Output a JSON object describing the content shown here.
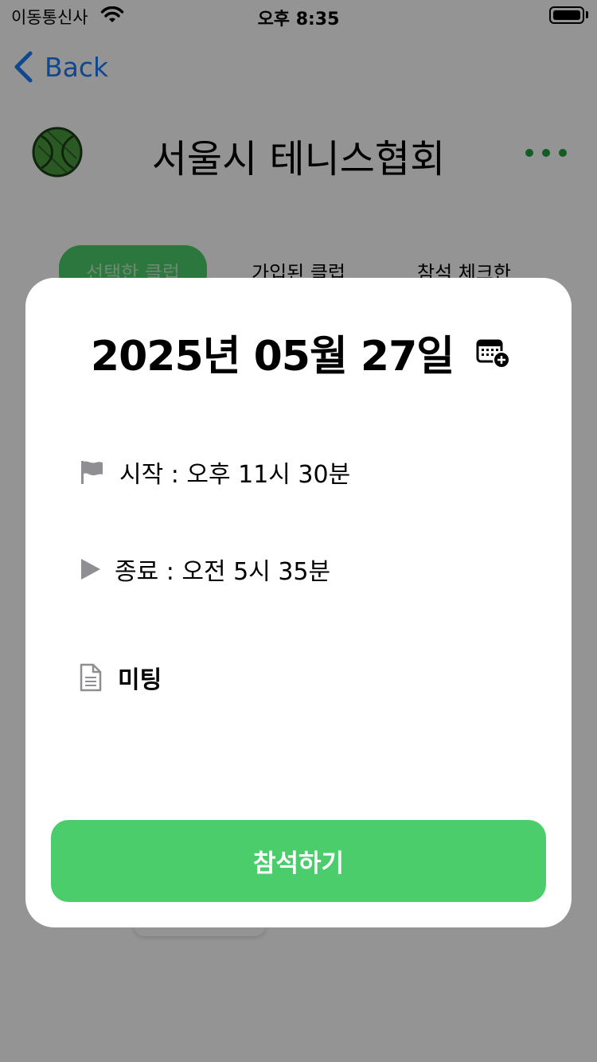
{
  "status_bar": {
    "carrier": "이동통신사",
    "time": "오후 8:35"
  },
  "nav": {
    "back_label": "Back"
  },
  "club": {
    "title": "서울시 테니스협회"
  },
  "tabs": [
    {
      "label": "선택한 클럽"
    },
    {
      "label": "가입된 클럽"
    },
    {
      "label": "참석 체크한"
    }
  ],
  "modal": {
    "date": "2025년 05월 27일",
    "start": "시작 : 오후 11시 30분",
    "end": "종료 : 오전 5시 35분",
    "note": "미팅",
    "attend_label": "참석하기"
  },
  "colors": {
    "accent_green": "#4ccd6b",
    "link_blue": "#1a7cf5",
    "dot_green": "#22a03e"
  }
}
